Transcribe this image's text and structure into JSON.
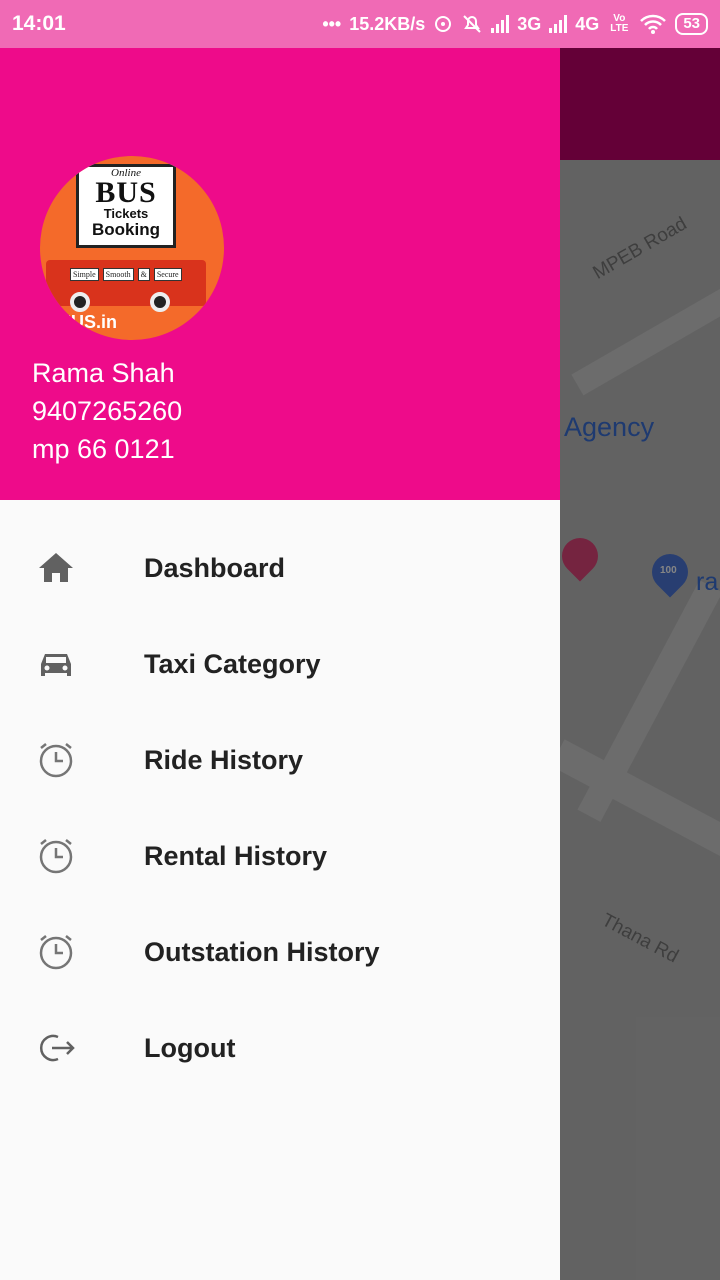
{
  "status_bar": {
    "time": "14:01",
    "dots": "•••",
    "speed": "15.2KB/s",
    "net_3g": "3G",
    "net_4g": "4G",
    "volte": "Vo LTE",
    "battery": "53"
  },
  "map": {
    "road_labels": [
      "MPEB Road",
      "Thana Rd"
    ],
    "place_label": "i Agency",
    "place_label_2": "ra",
    "pin_number": "100"
  },
  "drawer": {
    "logo": {
      "online": "Online",
      "bus": "BUS",
      "tickets": "Tickets",
      "booking": "Booking",
      "tags": [
        "Simple",
        "Smooth",
        "&",
        "Secure"
      ],
      "url": "IUS.in"
    },
    "user": {
      "name": "Rama Shah",
      "phone": "9407265260",
      "vehicle": "mp 66 0121"
    },
    "menu": [
      {
        "label": "Dashboard",
        "icon": "home-icon"
      },
      {
        "label": "Taxi Category",
        "icon": "car-icon"
      },
      {
        "label": "Ride History",
        "icon": "clock-icon"
      },
      {
        "label": "Rental History",
        "icon": "clock-icon"
      },
      {
        "label": "Outstation History",
        "icon": "clock-icon"
      },
      {
        "label": "Logout",
        "icon": "logout-icon"
      }
    ]
  },
  "colors": {
    "drawer_header": "#ee0b8a",
    "status_bar": "#f06ab5",
    "toolbar": "#c0006a"
  }
}
